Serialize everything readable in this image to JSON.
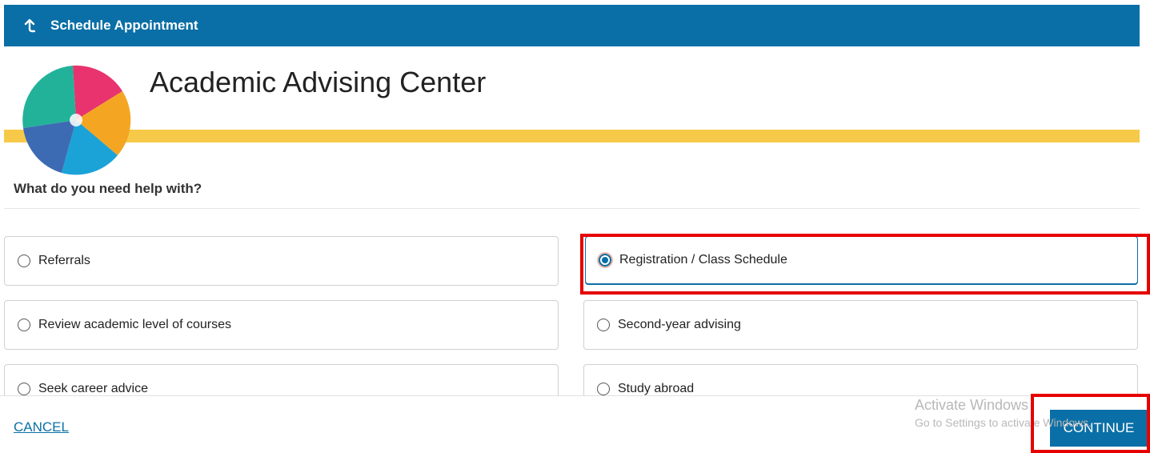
{
  "header": {
    "back_icon": "back-arrow-icon",
    "title": "Schedule Appointment"
  },
  "banner": {
    "title": "Academic Advising Center",
    "logo_icon": "advising-wheel-logo"
  },
  "question": "What do you need help with?",
  "options": [
    {
      "label": "Referrals",
      "selected": false
    },
    {
      "label": "Registration / Class Schedule",
      "selected": true
    },
    {
      "label": "Review academic level of courses",
      "selected": false
    },
    {
      "label": "Second-year advising",
      "selected": false
    },
    {
      "label": "Seek career advice",
      "selected": false
    },
    {
      "label": "Study abroad",
      "selected": false
    }
  ],
  "footer": {
    "cancel_label": "CANCEL",
    "continue_label": "CONTINUE"
  },
  "watermark": {
    "line1": "Activate Windows",
    "line2": "Go to Settings to activate Windows."
  },
  "colors": {
    "primary": "#0a6fa6",
    "accent_yellow": "#f7c948",
    "highlight_red": "#e60000"
  }
}
